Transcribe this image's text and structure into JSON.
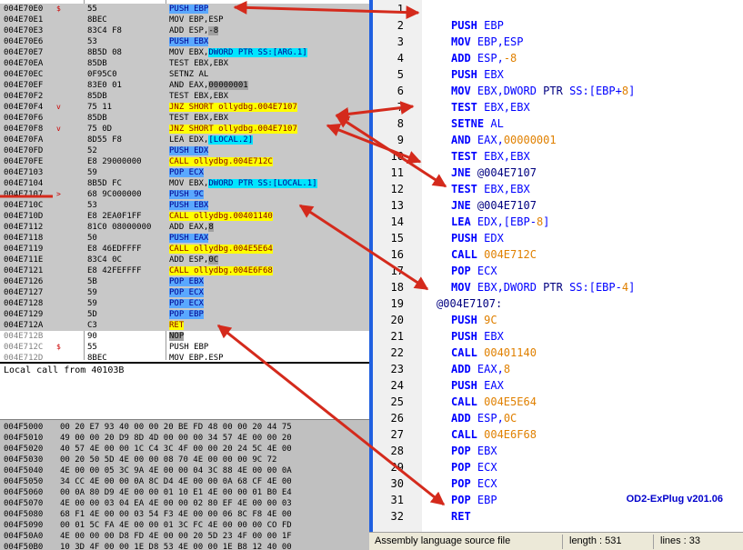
{
  "disasm": {
    "rows": [
      {
        "addr": "004E70E0",
        "gut": "$",
        "hex": "55",
        "pre": "",
        "hl": "PUSH EBP",
        "hlc": "blue",
        "post": ""
      },
      {
        "addr": "004E70E1",
        "gut": "",
        "hex": "8BEC",
        "pre": "MOV EBP,ESP",
        "hl": "",
        "hlc": "",
        "post": ""
      },
      {
        "addr": "004E70E3",
        "gut": "",
        "hex": "83C4 F8",
        "pre": "ADD ESP,",
        "hl": "-8",
        "hlc": "gray",
        "post": ""
      },
      {
        "addr": "004E70E6",
        "gut": "",
        "hex": "53",
        "pre": "",
        "hl": "PUSH EBX",
        "hlc": "blue",
        "post": ""
      },
      {
        "addr": "004E70E7",
        "gut": "",
        "hex": "8B5D 08",
        "pre": "MOV EBX,",
        "hl": "DWORD PTR SS:[ARG.1]",
        "hlc": "cyan",
        "post": ""
      },
      {
        "addr": "004E70EA",
        "gut": "",
        "hex": "85DB",
        "pre": "TEST EBX,EBX",
        "hl": "",
        "hlc": "",
        "post": ""
      },
      {
        "addr": "004E70EC",
        "gut": "",
        "hex": "0F95C0",
        "pre": "SETNZ AL",
        "hl": "",
        "hlc": "",
        "post": ""
      },
      {
        "addr": "004E70EF",
        "gut": "",
        "hex": "83E0 01",
        "pre": "AND EAX,",
        "hl": "00000001",
        "hlc": "gray",
        "post": ""
      },
      {
        "addr": "004E70F2",
        "gut": "",
        "hex": "85DB",
        "pre": "TEST EBX,EBX",
        "hl": "",
        "hlc": "",
        "post": ""
      },
      {
        "addr": "004E70F4",
        "gut": "v",
        "hex": "75 11",
        "pre": "",
        "hl": "JNZ SHORT ollydbg.004E7107",
        "hlc": "yellow",
        "post": ""
      },
      {
        "addr": "004E70F6",
        "gut": "",
        "hex": "85DB",
        "pre": "TEST EBX,EBX",
        "hl": "",
        "hlc": "",
        "post": ""
      },
      {
        "addr": "004E70F8",
        "gut": "v",
        "hex": "75 0D",
        "pre": "",
        "hl": "JNZ SHORT ollydbg.004E7107",
        "hlc": "yellow",
        "post": ""
      },
      {
        "addr": "004E70FA",
        "gut": "",
        "hex": "8D55 F8",
        "pre": "LEA EDX,",
        "hl": "[LOCAL.2]",
        "hlc": "cyan",
        "post": ""
      },
      {
        "addr": "004E70FD",
        "gut": "",
        "hex": "52",
        "pre": "",
        "hl": "PUSH EDX",
        "hlc": "blue",
        "post": ""
      },
      {
        "addr": "004E70FE",
        "gut": "",
        "hex": "E8 29000000",
        "pre": "",
        "hl": "CALL ollydbg.004E712C",
        "hlc": "yellow",
        "post": ""
      },
      {
        "addr": "004E7103",
        "gut": "",
        "hex": "59",
        "pre": "",
        "hl": "POP ECX",
        "hlc": "blue",
        "post": ""
      },
      {
        "addr": "004E7104",
        "gut": "",
        "hex": "8B5D FC",
        "pre": "MOV EBX,",
        "hl": "DWORD PTR SS:[LOCAL.1]",
        "hlc": "cyan",
        "post": ""
      },
      {
        "addr": "004E7107",
        "gut": ">",
        "hex": "68 9C000000",
        "pre": "",
        "hl": "PUSH 9C",
        "hlc": "blue",
        "post": ""
      },
      {
        "addr": "004E710C",
        "gut": "",
        "hex": "53",
        "pre": "",
        "hl": "PUSH EBX",
        "hlc": "blue",
        "post": ""
      },
      {
        "addr": "004E710D",
        "gut": "",
        "hex": "E8 2EA0F1FF",
        "pre": "",
        "hl": "CALL ollydbg.00401140",
        "hlc": "yellow",
        "post": ""
      },
      {
        "addr": "004E7112",
        "gut": "",
        "hex": "81C0 08000000",
        "pre": "ADD EAX,",
        "hl": "8",
        "hlc": "gray",
        "post": ""
      },
      {
        "addr": "004E7118",
        "gut": "",
        "hex": "50",
        "pre": "",
        "hl": "PUSH EAX",
        "hlc": "blue",
        "post": ""
      },
      {
        "addr": "004E7119",
        "gut": "",
        "hex": "E8 46EDFFFF",
        "pre": "",
        "hl": "CALL ollydbg.004E5E64",
        "hlc": "yellow",
        "post": ""
      },
      {
        "addr": "004E711E",
        "gut": "",
        "hex": "83C4 0C",
        "pre": "ADD ESP,",
        "hl": "0C",
        "hlc": "gray",
        "post": ""
      },
      {
        "addr": "004E7121",
        "gut": "",
        "hex": "E8 42FEFFFF",
        "pre": "",
        "hl": "CALL ollydbg.004E6F68",
        "hlc": "yellow",
        "post": ""
      },
      {
        "addr": "004E7126",
        "gut": "",
        "hex": "5B",
        "pre": "",
        "hl": "POP EBX",
        "hlc": "blue",
        "post": ""
      },
      {
        "addr": "004E7127",
        "gut": "",
        "hex": "59",
        "pre": "",
        "hl": "POP ECX",
        "hlc": "blue",
        "post": ""
      },
      {
        "addr": "004E7128",
        "gut": "",
        "hex": "59",
        "pre": "",
        "hl": "POP ECX",
        "hlc": "blue",
        "post": ""
      },
      {
        "addr": "004E7129",
        "gut": "",
        "hex": "5D",
        "pre": "",
        "hl": "POP EBP",
        "hlc": "blue",
        "post": ""
      },
      {
        "addr": "004E712A",
        "gut": "",
        "hex": "C3",
        "pre": "",
        "hl": "RET",
        "hlc": "yellow",
        "post": ""
      },
      {
        "addr": "004E712B",
        "gut": "",
        "hex": "90",
        "pre": "",
        "hl": "NOP",
        "hlc": "gray",
        "post": ""
      },
      {
        "addr": "004E712C",
        "gut": "$",
        "hex": "55",
        "pre": "PUSH EBP",
        "hl": "",
        "hlc": "",
        "post": ""
      },
      {
        "addr": "004E712D",
        "gut": "",
        "hex": "8BEC",
        "pre": "MOV EBP,ESP",
        "hl": "",
        "hlc": "",
        "post": ""
      }
    ]
  },
  "info": {
    "text": "Local call from 40103B"
  },
  "dump": {
    "rows": [
      {
        "addr": "004F5000",
        "bytes": "00 20 E7 93 40 00 00 20 BE FD 48 00 00 20 44 75",
        "ascii": ""
      },
      {
        "addr": "004F5010",
        "bytes": "49 00 00 20 D9 8D 4D 00 00 00 34 57 4E 00 00 20",
        "ascii": ""
      },
      {
        "addr": "004F5020",
        "bytes": "40 57 4E 00 00 1C C4 3C 4F 00 00 20 24 5C 4E 00",
        "ascii": ""
      },
      {
        "addr": "004F5030",
        "bytes": "00 20 50 5D 4E 00 00 08 70 4E 00 00 00 9C 72",
        "ascii": ""
      },
      {
        "addr": "004F5040",
        "bytes": "4E 00 00 05 3C 9A 4E 00 00 04 3C 88 4E 00 00 0A",
        "ascii": ""
      },
      {
        "addr": "004F5050",
        "bytes": "34 CC 4E 00 00 0A 8C D4 4E 00 00 0A 68 CF 4E 00",
        "ascii": ""
      },
      {
        "addr": "004F5060",
        "bytes": "00 0A 80 D9 4E 00 00 01 10 E1 4E 00 00 01 B0 E4",
        "ascii": ""
      },
      {
        "addr": "004F5070",
        "bytes": "4E 00 00 03 04 EA 4E 00 00 02 80 EF 4E 00 00 03",
        "ascii": ""
      },
      {
        "addr": "004F5080",
        "bytes": "68 F1 4E 00 00 03 54 F3 4E 00 00 06 8C F8 4E 00",
        "ascii": ""
      },
      {
        "addr": "004F5090",
        "bytes": "00 01 5C FA 4E 00 00 01 3C FC 4E 00 00 00 CO FD",
        "ascii": ""
      },
      {
        "addr": "004F50A0",
        "bytes": "4E 00 00 00 D8 FD 4E 00 00 20 5D 23 4F 00 00 1F",
        "ascii": ""
      },
      {
        "addr": "004F50B0",
        "bytes": "10 3D 4F 00 00 1E D8 53 4E 00 00 1E B8 12 40 00",
        "ascii": ""
      }
    ]
  },
  "editor": {
    "lines": [
      {
        "n": "1",
        "label": false,
        "parts": []
      },
      {
        "n": "2",
        "label": false,
        "parts": [
          {
            "t": "PUSH ",
            "c": "kw"
          },
          {
            "t": "EBP",
            "c": "reg"
          }
        ]
      },
      {
        "n": "3",
        "label": false,
        "parts": [
          {
            "t": "MOV ",
            "c": "kw"
          },
          {
            "t": "EBP,ESP",
            "c": "reg"
          }
        ]
      },
      {
        "n": "4",
        "label": false,
        "parts": [
          {
            "t": "ADD ",
            "c": "kw"
          },
          {
            "t": "ESP,",
            "c": "reg"
          },
          {
            "t": "-8",
            "c": "num"
          }
        ]
      },
      {
        "n": "5",
        "label": false,
        "parts": [
          {
            "t": "PUSH ",
            "c": "kw"
          },
          {
            "t": "EBX",
            "c": "reg"
          }
        ]
      },
      {
        "n": "6",
        "label": false,
        "parts": [
          {
            "t": "MOV ",
            "c": "kw"
          },
          {
            "t": "EBX,DWORD ",
            "c": "reg"
          },
          {
            "t": "PTR ",
            "c": "plain"
          },
          {
            "t": "SS:[EBP+",
            "c": "reg"
          },
          {
            "t": "8",
            "c": "num"
          },
          {
            "t": "]",
            "c": "reg"
          }
        ]
      },
      {
        "n": "7",
        "label": false,
        "parts": [
          {
            "t": "TEST ",
            "c": "kw"
          },
          {
            "t": "EBX,EBX",
            "c": "reg"
          }
        ]
      },
      {
        "n": "8",
        "label": false,
        "parts": [
          {
            "t": "SETNE ",
            "c": "kw"
          },
          {
            "t": "AL",
            "c": "reg"
          }
        ]
      },
      {
        "n": "9",
        "label": false,
        "parts": [
          {
            "t": "AND ",
            "c": "kw"
          },
          {
            "t": "EAX,",
            "c": "reg"
          },
          {
            "t": "00000001",
            "c": "num"
          }
        ]
      },
      {
        "n": "10",
        "label": false,
        "parts": [
          {
            "t": "TEST ",
            "c": "kw"
          },
          {
            "t": "EBX,EBX",
            "c": "reg"
          }
        ]
      },
      {
        "n": "11",
        "label": false,
        "parts": [
          {
            "t": "JNE ",
            "c": "kw"
          },
          {
            "t": "@004E7107",
            "c": "plain"
          }
        ]
      },
      {
        "n": "12",
        "label": false,
        "parts": [
          {
            "t": "TEST ",
            "c": "kw"
          },
          {
            "t": "EBX,EBX",
            "c": "reg"
          }
        ]
      },
      {
        "n": "13",
        "label": false,
        "parts": [
          {
            "t": "JNE ",
            "c": "kw"
          },
          {
            "t": "@004E7107",
            "c": "plain"
          }
        ]
      },
      {
        "n": "14",
        "label": false,
        "parts": [
          {
            "t": "LEA ",
            "c": "kw"
          },
          {
            "t": "EDX,[EBP-",
            "c": "reg"
          },
          {
            "t": "8",
            "c": "num"
          },
          {
            "t": "]",
            "c": "reg"
          }
        ]
      },
      {
        "n": "15",
        "label": false,
        "parts": [
          {
            "t": "PUSH ",
            "c": "kw"
          },
          {
            "t": "EDX",
            "c": "reg"
          }
        ]
      },
      {
        "n": "16",
        "label": false,
        "parts": [
          {
            "t": "CALL ",
            "c": "kw"
          },
          {
            "t": "004E712C",
            "c": "num"
          }
        ]
      },
      {
        "n": "17",
        "label": false,
        "parts": [
          {
            "t": "POP ",
            "c": "kw"
          },
          {
            "t": "ECX",
            "c": "reg"
          }
        ]
      },
      {
        "n": "18",
        "label": false,
        "parts": [
          {
            "t": "MOV ",
            "c": "kw"
          },
          {
            "t": "EBX,DWORD ",
            "c": "reg"
          },
          {
            "t": "PTR ",
            "c": "plain"
          },
          {
            "t": "SS:[EBP-",
            "c": "reg"
          },
          {
            "t": "4",
            "c": "num"
          },
          {
            "t": "]",
            "c": "reg"
          }
        ]
      },
      {
        "n": "19",
        "label": true,
        "parts": [
          {
            "t": "@004E7107:",
            "c": "plain"
          }
        ]
      },
      {
        "n": "20",
        "label": false,
        "parts": [
          {
            "t": "PUSH ",
            "c": "kw"
          },
          {
            "t": "9C",
            "c": "num"
          }
        ]
      },
      {
        "n": "21",
        "label": false,
        "parts": [
          {
            "t": "PUSH ",
            "c": "kw"
          },
          {
            "t": "EBX",
            "c": "reg"
          }
        ]
      },
      {
        "n": "22",
        "label": false,
        "parts": [
          {
            "t": "CALL ",
            "c": "kw"
          },
          {
            "t": "00401140",
            "c": "num"
          }
        ]
      },
      {
        "n": "23",
        "label": false,
        "parts": [
          {
            "t": "ADD ",
            "c": "kw"
          },
          {
            "t": "EAX,",
            "c": "reg"
          },
          {
            "t": "8",
            "c": "num"
          }
        ]
      },
      {
        "n": "24",
        "label": false,
        "parts": [
          {
            "t": "PUSH ",
            "c": "kw"
          },
          {
            "t": "EAX",
            "c": "reg"
          }
        ]
      },
      {
        "n": "25",
        "label": false,
        "parts": [
          {
            "t": "CALL ",
            "c": "kw"
          },
          {
            "t": "004E5E64",
            "c": "num"
          }
        ]
      },
      {
        "n": "26",
        "label": false,
        "parts": [
          {
            "t": "ADD ",
            "c": "kw"
          },
          {
            "t": "ESP,",
            "c": "reg"
          },
          {
            "t": "0C",
            "c": "num"
          }
        ]
      },
      {
        "n": "27",
        "label": false,
        "parts": [
          {
            "t": "CALL ",
            "c": "kw"
          },
          {
            "t": "004E6F68",
            "c": "num"
          }
        ]
      },
      {
        "n": "28",
        "label": false,
        "parts": [
          {
            "t": "POP ",
            "c": "kw"
          },
          {
            "t": "EBX",
            "c": "reg"
          }
        ]
      },
      {
        "n": "29",
        "label": false,
        "parts": [
          {
            "t": "POP ",
            "c": "kw"
          },
          {
            "t": "ECX",
            "c": "reg"
          }
        ]
      },
      {
        "n": "30",
        "label": false,
        "parts": [
          {
            "t": "POP ",
            "c": "kw"
          },
          {
            "t": "ECX",
            "c": "reg"
          }
        ]
      },
      {
        "n": "31",
        "label": false,
        "parts": [
          {
            "t": "POP ",
            "c": "kw"
          },
          {
            "t": "EBP",
            "c": "reg"
          }
        ]
      },
      {
        "n": "32",
        "label": false,
        "parts": [
          {
            "t": "RET",
            "c": "kw"
          }
        ]
      }
    ],
    "branding": "OD2-ExPlug v201.06"
  },
  "status": {
    "file_type": "Assembly language source file",
    "length": "length : 531",
    "lines": "lines : 33"
  },
  "colors": {
    "arrow": "#d42a1c",
    "editor_border": "#2060e0"
  }
}
